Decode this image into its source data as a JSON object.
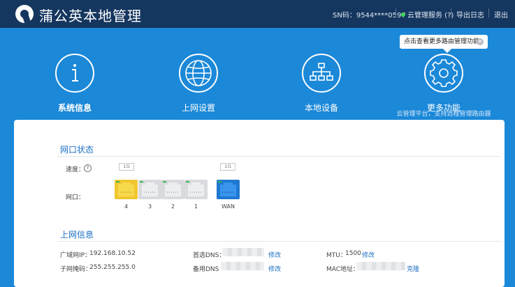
{
  "header": {
    "title": "蒲公英本地管理",
    "sn": "SN码：9544****0597",
    "cloud_service": "云管理服务 (?)",
    "export_log": "导出日志",
    "logout": "退出"
  },
  "colors": {
    "topbar": "#15365e",
    "background": "#1b88d8",
    "accent": "#1b6fc2",
    "status_ok": "#3fd35b"
  },
  "tooltip": {
    "text": "点击查看更多路由管理功能",
    "close_icon": "close-icon"
  },
  "nav": {
    "items": [
      {
        "label": "系统信息",
        "icon": "info-icon",
        "active": true
      },
      {
        "label": "上网设置",
        "icon": "globe-icon",
        "active": false
      },
      {
        "label": "本地设备",
        "icon": "network-icon",
        "active": false
      },
      {
        "label": "更多功能",
        "icon": "gear-icon",
        "active": false
      }
    ],
    "more_sub": "云管理平台，支持远程管理路由器"
  },
  "network_status": {
    "title": "网口状态",
    "speed_label": "速度：",
    "port_label": "网口：",
    "speed_tag_lan": "1G",
    "speed_tag_wan": "1G",
    "ports": [
      {
        "number": "4",
        "state": "active-yellow"
      },
      {
        "number": "3",
        "state": "inactive"
      },
      {
        "number": "2",
        "state": "inactive"
      },
      {
        "number": "1",
        "state": "inactive"
      },
      {
        "number": "WAN",
        "state": "active-blue"
      }
    ]
  },
  "internet_info": {
    "title": "上网信息",
    "wan_ip_label": "广域网IP：",
    "wan_ip": "192.168.10.52",
    "subnet_label": "子网掩码：",
    "subnet": "255.255.255.0",
    "dns1_label": "首选DNS：",
    "dns1_edit": "修改",
    "dns2_label": "备用DNS",
    "dns2_edit": "修改",
    "mtu_label": "MTU：",
    "mtu": "1500",
    "mtu_edit": "修改",
    "mac_label": "MAC地址：",
    "mac_clone": "克隆"
  }
}
